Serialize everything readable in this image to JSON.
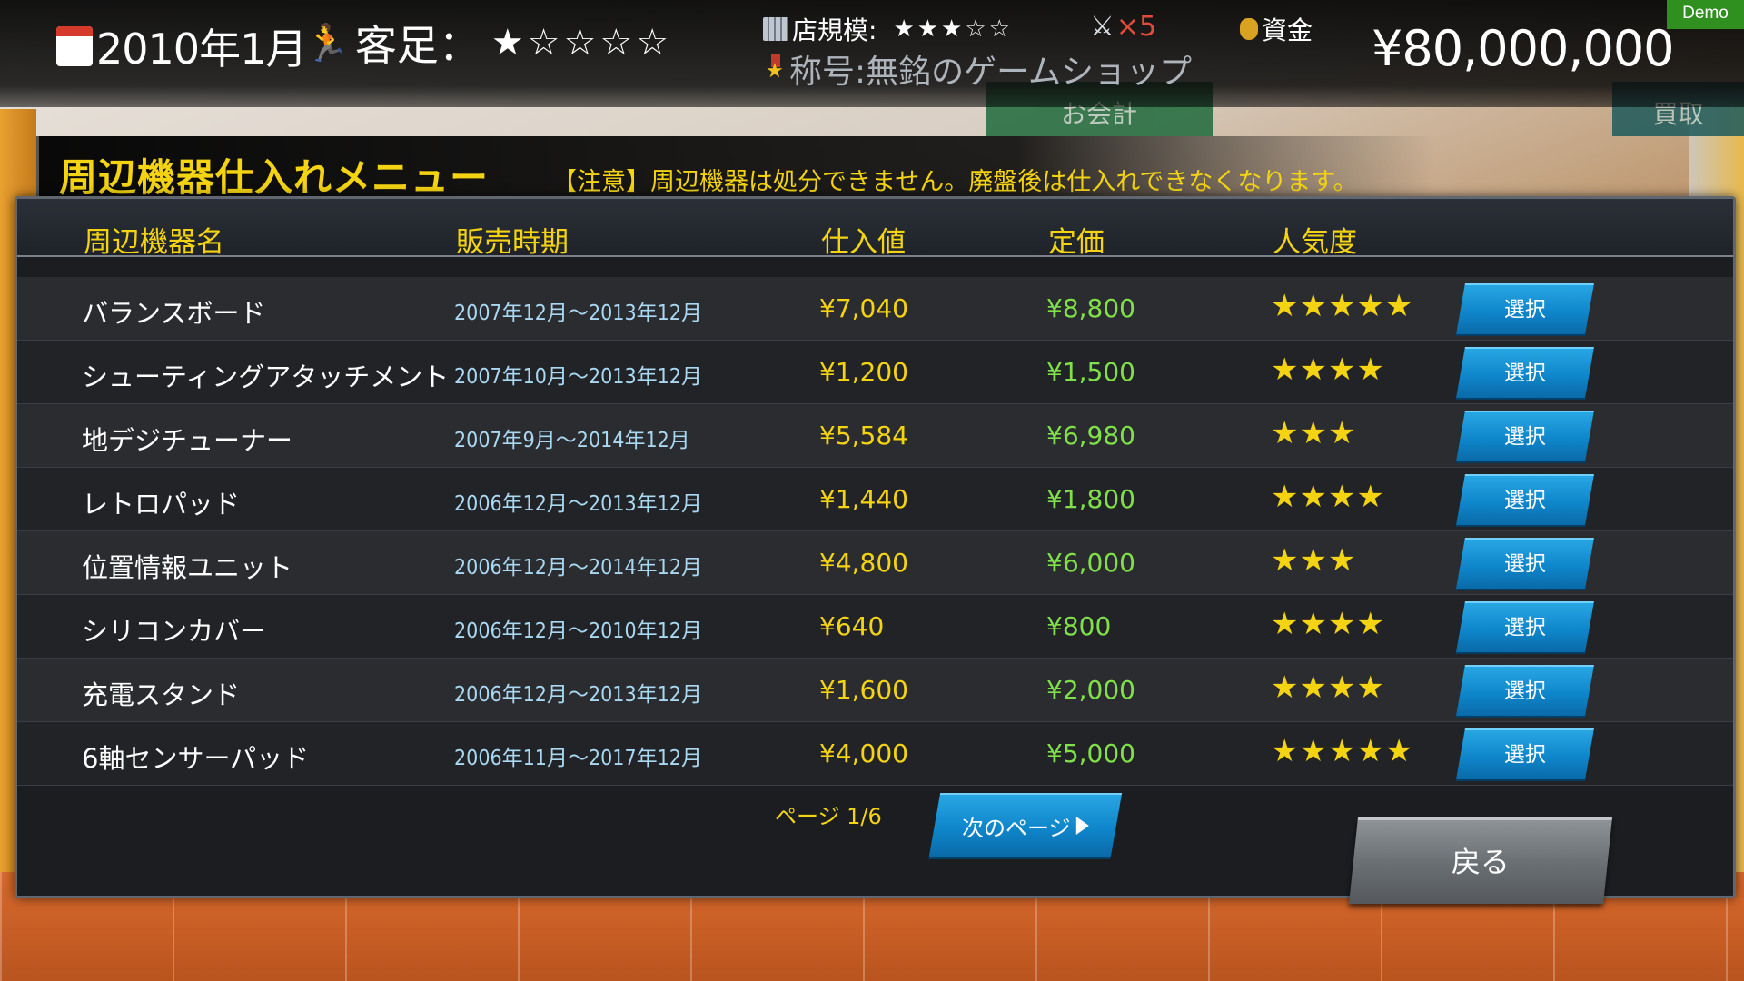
{
  "status_bar": {
    "date": "2010年1月",
    "customer_label": "客足：",
    "customer_stars": "★☆☆☆☆",
    "store_scale_label": "店規模:",
    "store_scale_stars": "★★★☆☆",
    "tool_multiplier": "×5",
    "funds_label": "資金",
    "funds_value": "¥80,000,000",
    "title_label": "称号:無銘のゲームショップ",
    "demo_badge": "Demo"
  },
  "background": {
    "counter_sign": "お会計",
    "counter_sign_right": "買取"
  },
  "menu": {
    "title": "周辺機器仕入れメニュー",
    "notice": "【注意】周辺機器は処分できません。廃盤後は仕入れできなくなります。",
    "columns": {
      "name": "周辺機器名",
      "period": "販売時期",
      "cost": "仕入値",
      "price": "定価",
      "popularity": "人気度"
    },
    "rows": [
      {
        "name": "バランスボード",
        "period": "2007年12月～2013年12月",
        "cost": "¥7,040",
        "price": "¥8,800",
        "popularity": "★★★★★",
        "action": "選択"
      },
      {
        "name": "シューティングアタッチメント",
        "period": "2007年10月～2013年12月",
        "cost": "¥1,200",
        "price": "¥1,500",
        "popularity": "★★★★",
        "action": "選択"
      },
      {
        "name": "地デジチューナー",
        "period": "2007年9月～2014年12月",
        "cost": "¥5,584",
        "price": "¥6,980",
        "popularity": "★★★",
        "action": "選択"
      },
      {
        "name": "レトロパッド",
        "period": "2006年12月～2013年12月",
        "cost": "¥1,440",
        "price": "¥1,800",
        "popularity": "★★★★",
        "action": "選択"
      },
      {
        "name": "位置情報ユニット",
        "period": "2006年12月～2014年12月",
        "cost": "¥4,800",
        "price": "¥6,000",
        "popularity": "★★★",
        "action": "選択"
      },
      {
        "name": "シリコンカバー",
        "period": "2006年12月～2010年12月",
        "cost": "¥640",
        "price": "¥800",
        "popularity": "★★★★",
        "action": "選択"
      },
      {
        "name": "充電スタンド",
        "period": "2006年12月～2013年12月",
        "cost": "¥1,600",
        "price": "¥2,000",
        "popularity": "★★★★",
        "action": "選択"
      },
      {
        "name": "6軸センサーパッド",
        "period": "2006年11月～2017年12月",
        "cost": "¥4,000",
        "price": "¥5,000",
        "popularity": "★★★★★",
        "action": "選択"
      }
    ],
    "page_info": "ページ 1/6",
    "next_page_label": "次のページ",
    "back_label": "戻る"
  },
  "colors": {
    "accent_yellow": "#f4d313",
    "period_blue": "#a9d8f2",
    "price_green": "#7fe04a",
    "button_blue": "#0f86cb",
    "demo_green": "#2f8f1f"
  }
}
